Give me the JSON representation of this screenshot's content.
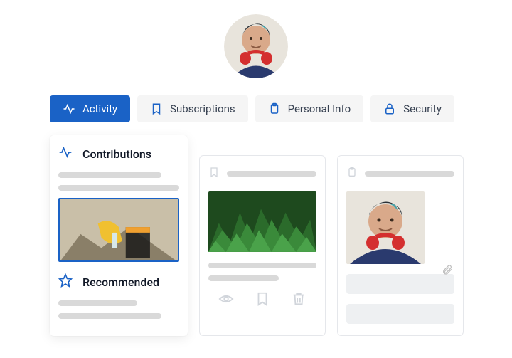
{
  "tabs": {
    "activity": "Activity",
    "subscriptions": "Subscriptions",
    "personal_info": "Personal Info",
    "security": "Security"
  },
  "sidepanel": {
    "contributions": "Contributions",
    "recommended": "Recommended"
  }
}
